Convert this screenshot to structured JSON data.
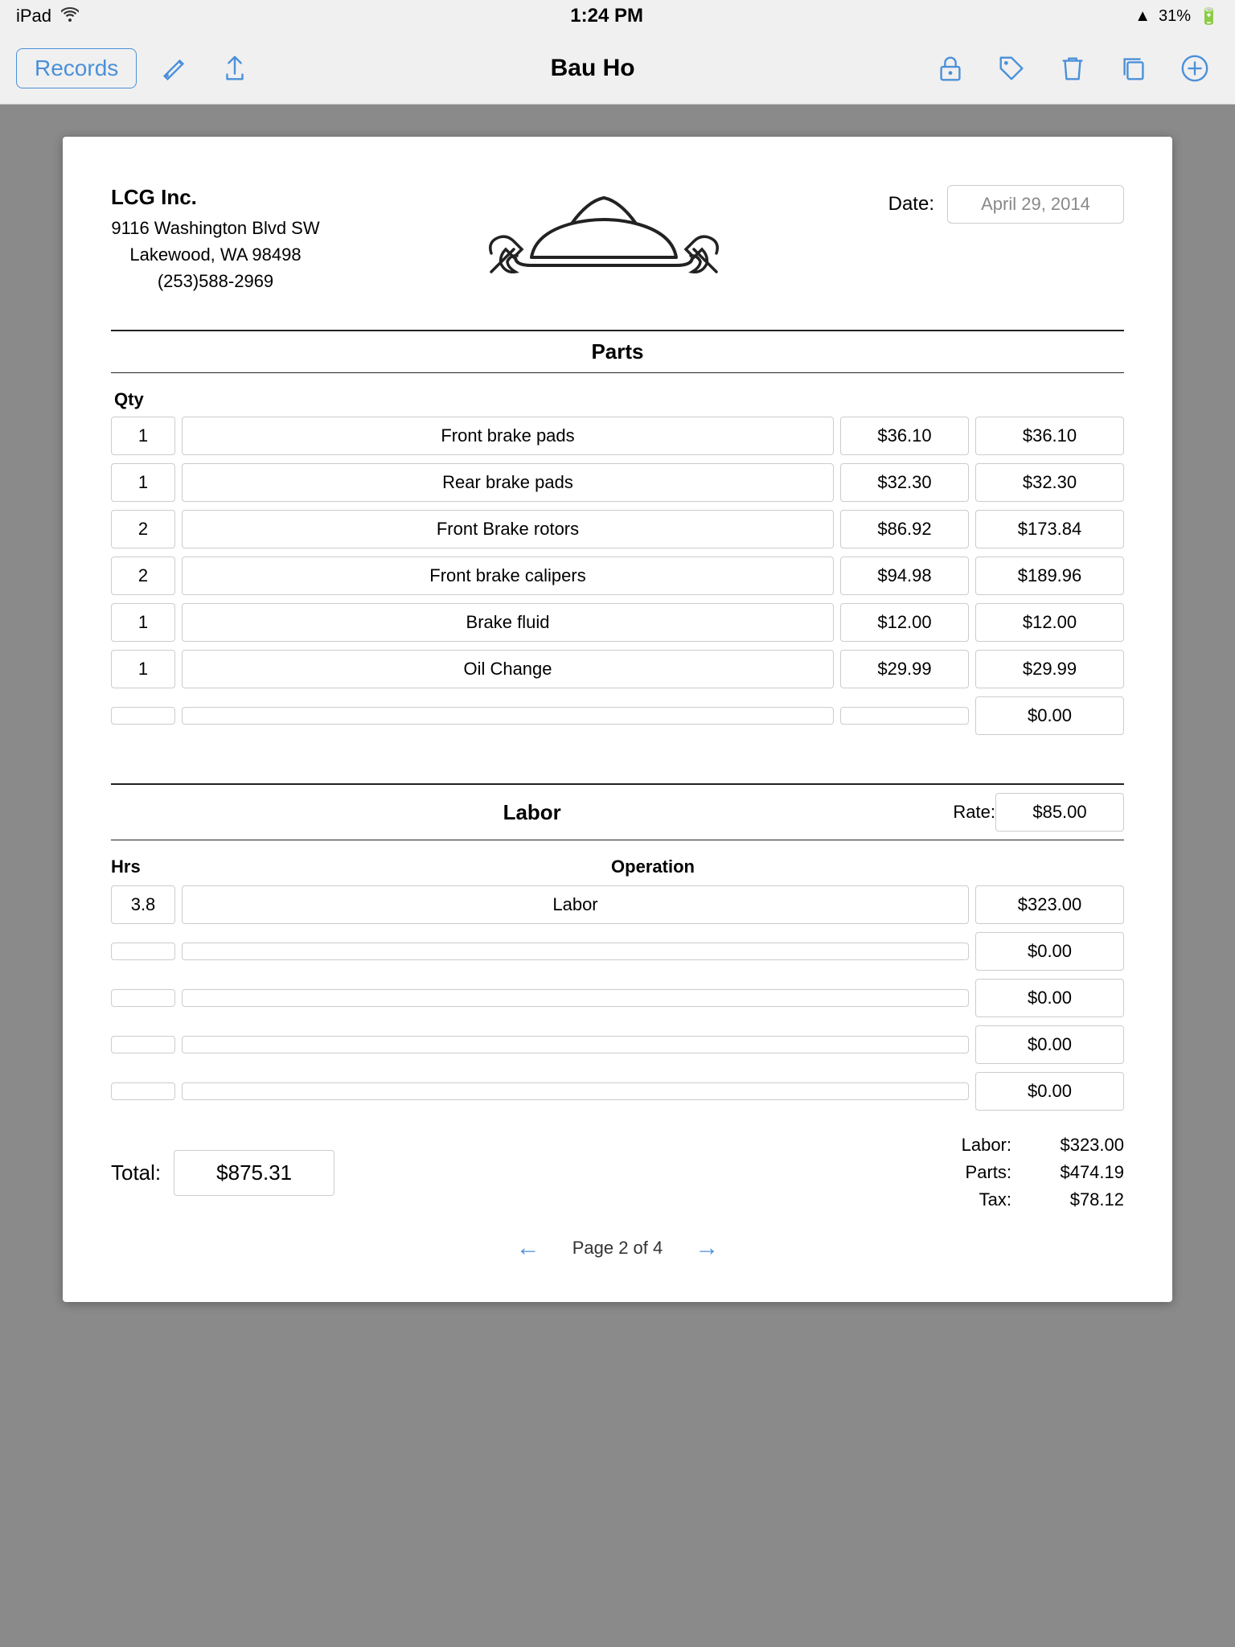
{
  "statusBar": {
    "device": "iPad",
    "wifi": true,
    "time": "1:24 PM",
    "signal": true,
    "battery": "31%"
  },
  "toolbar": {
    "title": "Bau Ho",
    "records_label": "Records"
  },
  "document": {
    "company": {
      "name": "LCG Inc.",
      "address_line1": "9116 Washington Blvd SW",
      "address_line2": "Lakewood, WA  98498",
      "phone": "(253)588-2969"
    },
    "date_label": "Date:",
    "date_value": "April 29, 2014",
    "sections": {
      "parts": {
        "title": "Parts",
        "col_qty": "Qty",
        "rows": [
          {
            "qty": "1",
            "desc": "Front brake pads",
            "price": "$36.10",
            "total": "$36.10"
          },
          {
            "qty": "1",
            "desc": "Rear brake pads",
            "price": "$32.30",
            "total": "$32.30"
          },
          {
            "qty": "2",
            "desc": "Front Brake rotors",
            "price": "$86.92",
            "total": "$173.84"
          },
          {
            "qty": "2",
            "desc": "Front brake calipers",
            "price": "$94.98",
            "total": "$189.96"
          },
          {
            "qty": "1",
            "desc": "Brake fluid",
            "price": "$12.00",
            "total": "$12.00"
          },
          {
            "qty": "1",
            "desc": "Oil Change",
            "price": "$29.99",
            "total": "$29.99"
          },
          {
            "qty": "",
            "desc": "",
            "price": "",
            "total": "$0.00"
          }
        ]
      },
      "labor": {
        "title": "Labor",
        "rate_label": "Rate:",
        "rate_value": "$85.00",
        "col_hrs": "Hrs",
        "col_operation": "Operation",
        "rows": [
          {
            "hrs": "3.8",
            "operation": "Labor",
            "amount": "$323.00"
          },
          {
            "hrs": "",
            "operation": "",
            "amount": "$0.00"
          },
          {
            "hrs": "",
            "operation": "",
            "amount": "$0.00"
          },
          {
            "hrs": "",
            "operation": "",
            "amount": "$0.00"
          },
          {
            "hrs": "",
            "operation": "",
            "amount": "$0.00"
          }
        ]
      }
    },
    "summary": {
      "total_label": "Total:",
      "total_value": "$875.31",
      "labor_label": "Labor:",
      "labor_value": "$323.00",
      "parts_label": "Parts:",
      "parts_value": "$474.19",
      "tax_label": "Tax:",
      "tax_value": "$78.12"
    },
    "pagination": {
      "text": "Page 2 of 4"
    }
  }
}
